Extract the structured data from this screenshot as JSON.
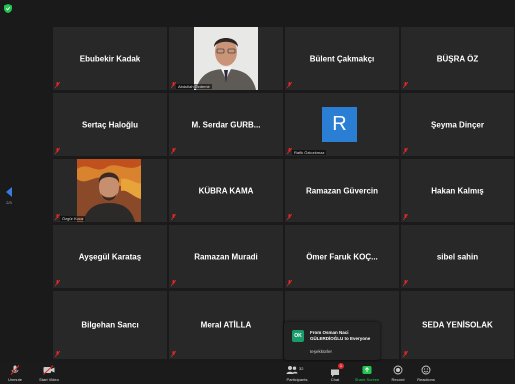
{
  "participants": [
    {
      "name": "Ebubekir Kadak",
      "video": false
    },
    {
      "name": "",
      "caption": "Abdullah Özdemir",
      "video": true
    },
    {
      "name": "Bülent Çakmakçı",
      "video": false
    },
    {
      "name": "BÜŞRA ÖZ",
      "video": false
    },
    {
      "name": "Sertaç Haloğlu",
      "video": false
    },
    {
      "name": "M. Serdar GURB...",
      "video": false
    },
    {
      "name": "",
      "caption": "Rafik Özkorkmaz",
      "avatar_letter": "R",
      "avatar_color": "#2a7fd4",
      "video": false
    },
    {
      "name": "Şeyma Dinçer",
      "video": false
    },
    {
      "name": "",
      "caption": "Özgür Koca",
      "video": true
    },
    {
      "name": "KÜBRA KAMA",
      "video": false
    },
    {
      "name": "Ramazan Güvercin",
      "video": false
    },
    {
      "name": "Hakan Kalmış",
      "video": false
    },
    {
      "name": "Ayşegül Karataş",
      "video": false
    },
    {
      "name": "Ramazan Muradi",
      "video": false
    },
    {
      "name": "Ömer Faruk KOÇ...",
      "video": false
    },
    {
      "name": "sibel sahin",
      "video": false
    },
    {
      "name": "Bilgehan Sancı",
      "video": false
    },
    {
      "name": "Meral ATİLLA",
      "video": false
    },
    {
      "name": "",
      "video": false
    },
    {
      "name": "SEDA YENİSOLAK",
      "video": false
    }
  ],
  "gallery_nav": {
    "page": "2/3"
  },
  "chat_popup": {
    "initials": "OK",
    "from_line1": "From Osman Naci",
    "from_line2": "GÜLERDİOĞLU to Everyone",
    "message": "teşekkürler"
  },
  "toolbar": {
    "unmute": "Unmute",
    "start_video": "Start Video",
    "participants": "Participants",
    "participants_count": "32",
    "chat": "Chat",
    "chat_badge": "1",
    "share_screen": "Share Screen",
    "record": "Record",
    "reactions": "Reactions"
  },
  "colors": {
    "background": "#1a1a1a",
    "tile": "#282828",
    "accent_blue": "#2a7fd4",
    "share_green": "#23c552",
    "mute_red": "#e02828"
  }
}
